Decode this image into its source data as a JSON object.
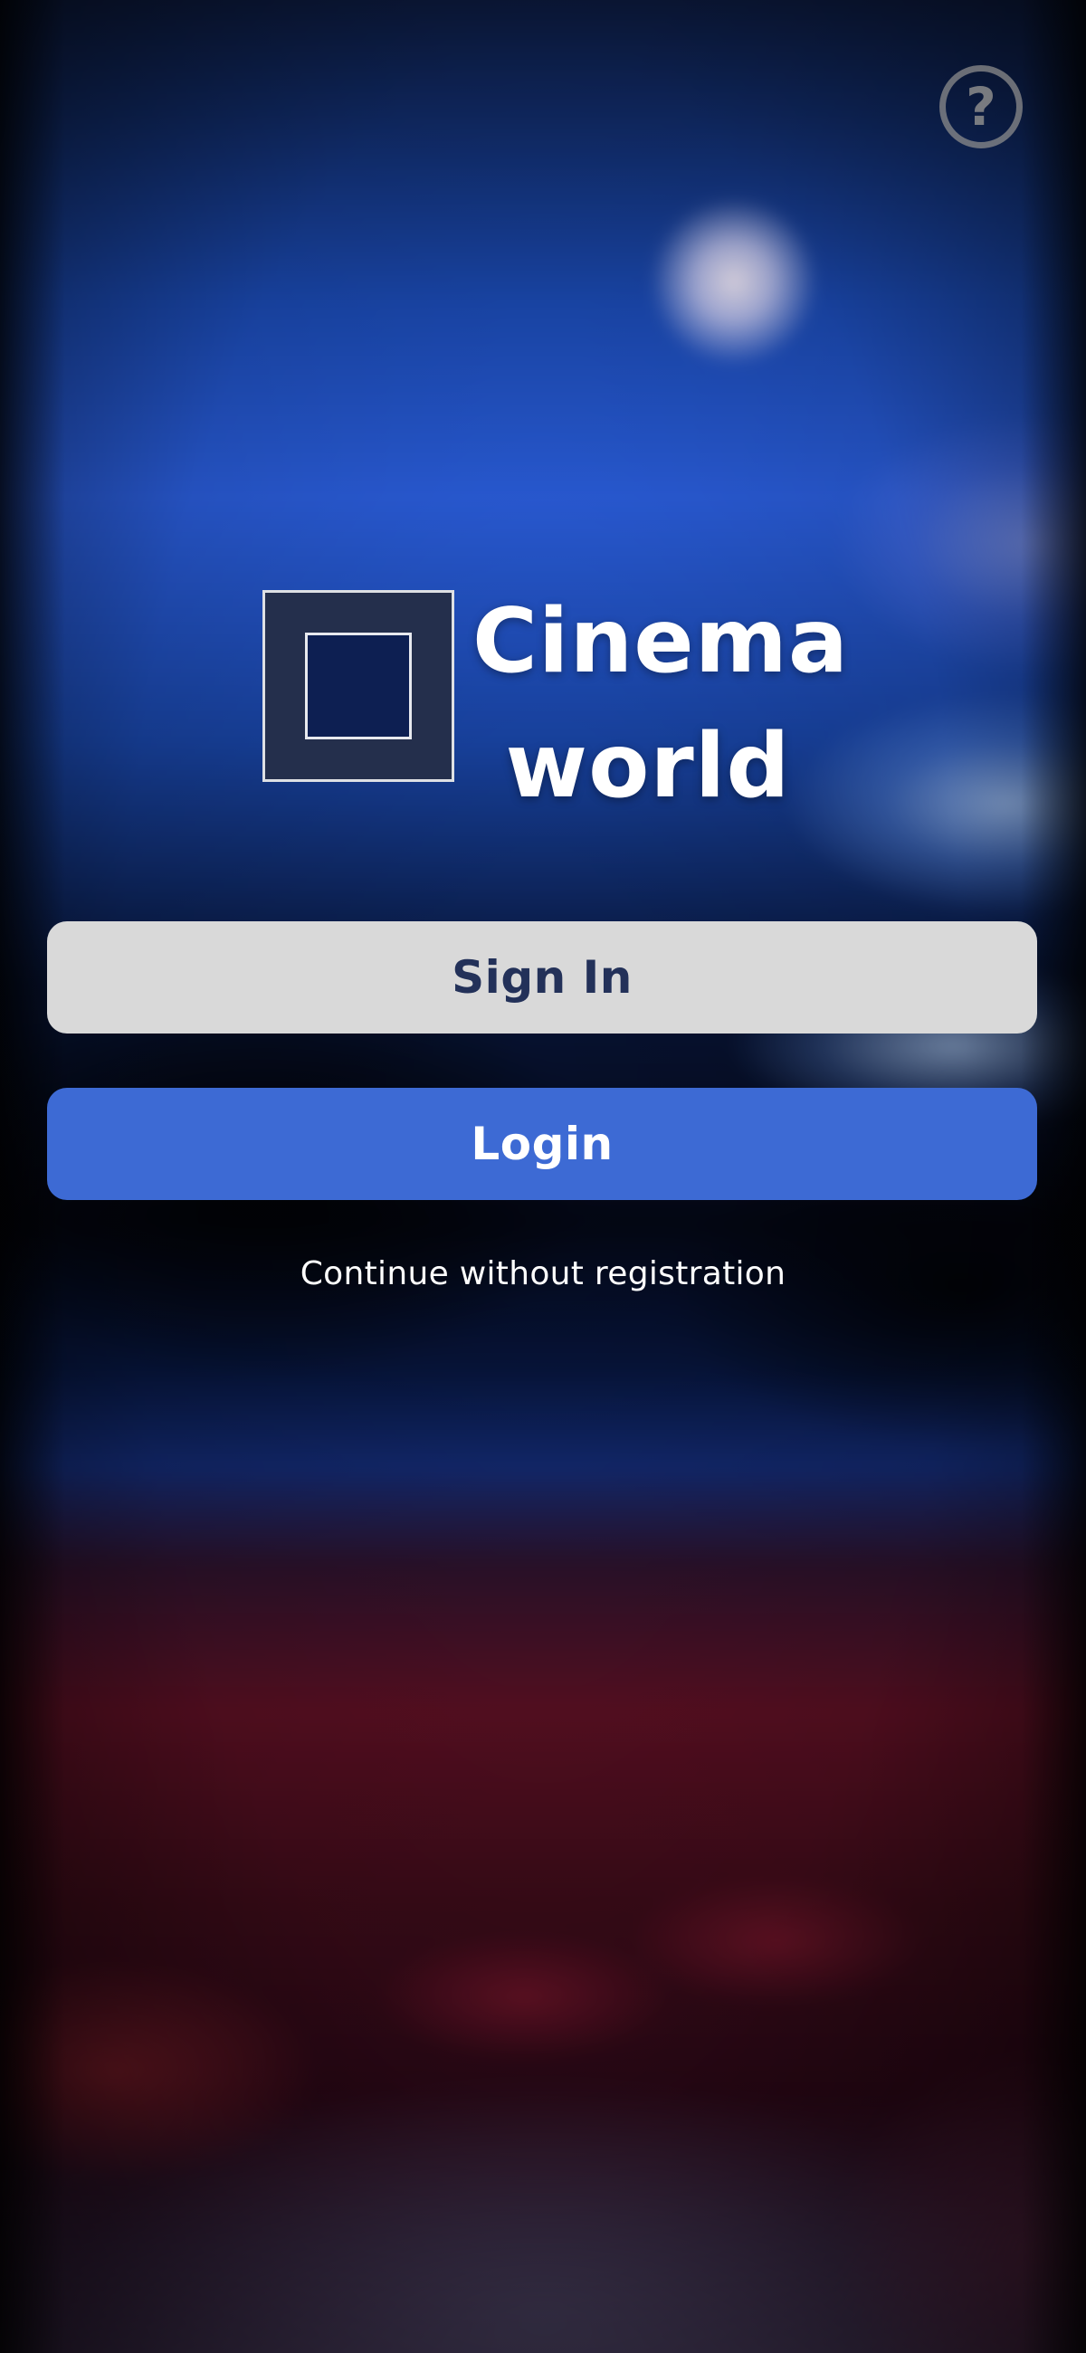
{
  "app": {
    "title_line1": "Cinema",
    "title_line2": "world"
  },
  "header": {
    "help_icon": "question-circle-icon",
    "help_glyph": "?"
  },
  "actions": {
    "sign_in_label": "Sign In",
    "login_label": "Login",
    "guest_link_label": "Continue without registration"
  },
  "theme": {
    "sign_in_bg": "#d9d9d9",
    "sign_in_text": "#233159",
    "login_bg": "#3d6ad4",
    "login_text": "#ffffff",
    "logo_bg": "#242f4c"
  }
}
